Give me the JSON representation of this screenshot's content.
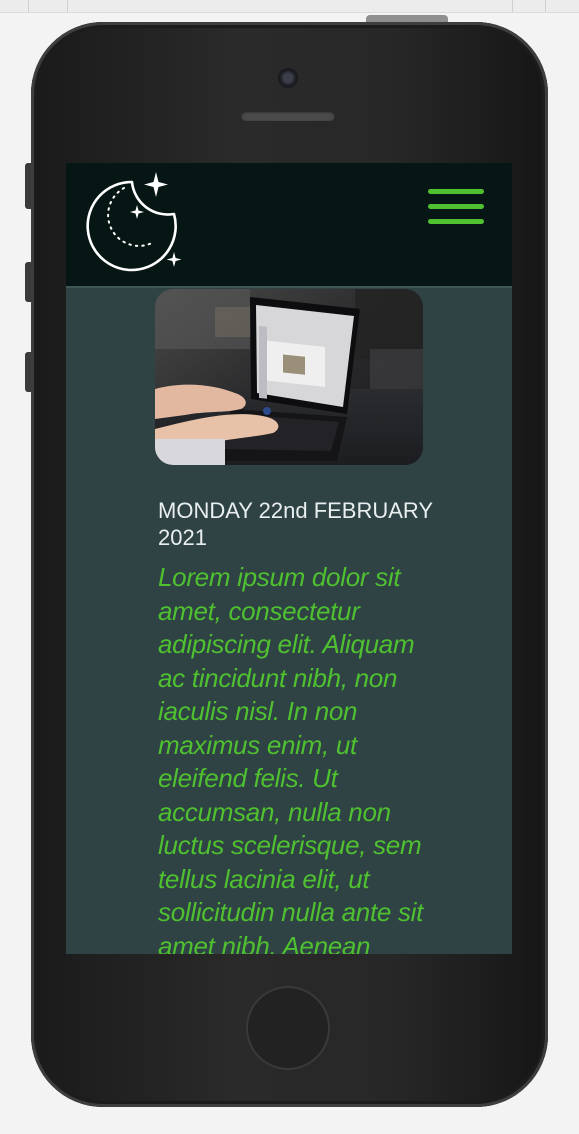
{
  "post": {
    "date": "MONDAY 22nd FEBRUARY 2021",
    "body": "Lorem ipsum dolor sit amet, consectetur adipiscing elit. Aliquam ac tincidunt nibh, non iaculis nisl. In non maximus enim, ut eleifend felis. Ut accumsan, nulla non luctus scelerisque, sem tellus lacinia elit, ut sollicitudin nulla ante sit amet nibh. Aenean"
  },
  "navbar": {
    "logo_icon": "moon-stars-icon",
    "menu_icon": "hamburger-menu-icon"
  },
  "colors": {
    "accent": "#4fc131",
    "navbar_bg": "#061615",
    "content_bg": "#2f4244",
    "date_text": "#e9eeee"
  }
}
